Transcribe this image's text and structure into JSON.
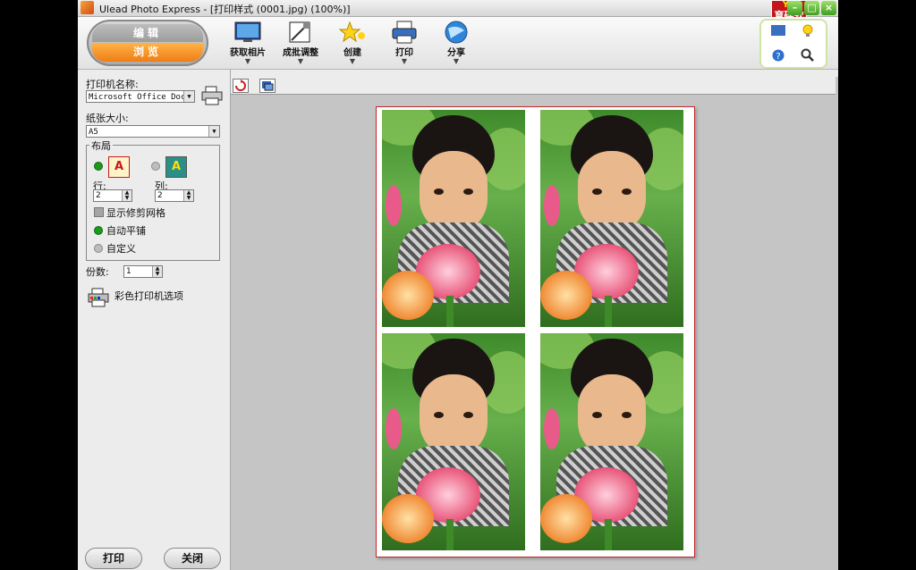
{
  "window": {
    "title": "Ulead Photo Express - [打印样式 (0001.jpg)  (100%)]"
  },
  "brand": {
    "logo_text": "育碟软件",
    "sub": "YY"
  },
  "mode": {
    "top": "编辑",
    "bottom": "浏览"
  },
  "toolbar": {
    "items": [
      {
        "label": "获取相片",
        "icon": "monitor-photo-icon"
      },
      {
        "label": "成批调整",
        "icon": "batch-adjust-icon"
      },
      {
        "label": "创建",
        "icon": "star-create-icon"
      },
      {
        "label": "打印",
        "icon": "printer-icon"
      },
      {
        "label": "分享",
        "icon": "globe-share-icon"
      }
    ]
  },
  "panel": {
    "printer_label": "打印机名称:",
    "printer_value": "Microsoft Office Docu",
    "paper_label": "纸张大小:",
    "paper_value": "A5",
    "layout_legend": "布局",
    "rows_label": "行:",
    "rows_value": "2",
    "cols_label": "列:",
    "cols_value": "2",
    "show_grid_label": "显示修剪网格",
    "auto_tile_label": "自动平铺",
    "custom_label": "自定义",
    "copies_label": "份数:",
    "copies_value": "1",
    "color_options_label": "彩色打印机选项"
  },
  "buttons": {
    "print": "打印",
    "close": "关闭"
  }
}
